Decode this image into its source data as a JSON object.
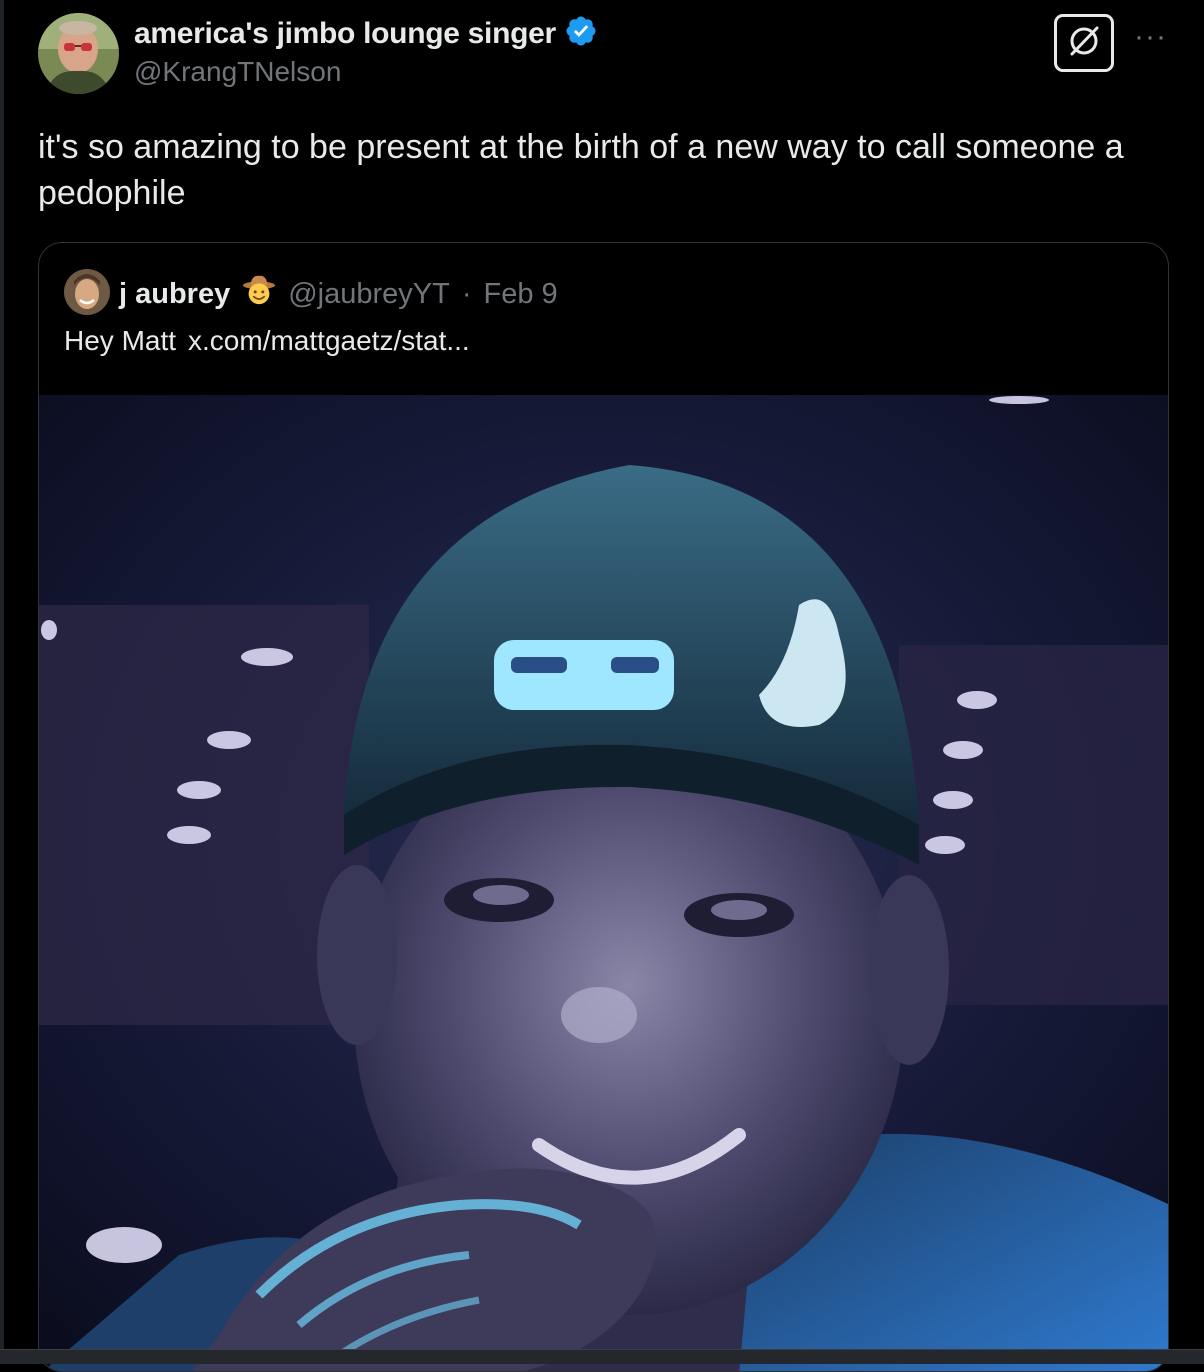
{
  "author": {
    "display_name": "america's jimbo lounge singer",
    "handle": "@KrangTNelson",
    "verified": true
  },
  "tweet_text": "it's so amazing to be present at the birth of a new way to call someone a pedophile",
  "actions": {
    "more_label": "···",
    "grok_icon": "grok-icon"
  },
  "quoted_tweet": {
    "display_name": "j aubrey",
    "emoji": "cowboy-face",
    "handle": "@jaubreyYT",
    "separator": "·",
    "date": "Feb 9",
    "text": "Hey Matt",
    "link": "x.com/mattgaetz/stat..."
  },
  "colors": {
    "background": "#000000",
    "text_primary": "#e7e9ea",
    "text_secondary": "#71767b",
    "verified_blue": "#1d9bf0",
    "card_border": "#2f3336"
  }
}
